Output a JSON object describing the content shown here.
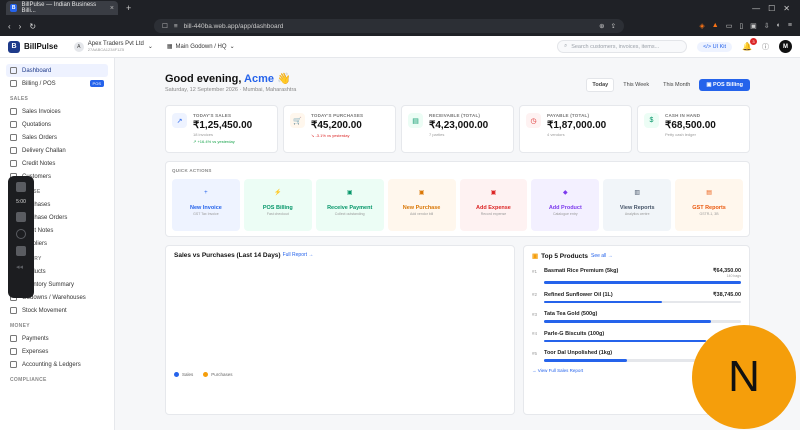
{
  "browser": {
    "tab_title": "BillPulse — Indian Business Billi...",
    "favicon_letter": "B",
    "url": "bill-440ba.web.app/app/dashboard"
  },
  "header": {
    "logo_text": "BillPulse",
    "logo_letter": "B",
    "company_initial": "A",
    "company_name": "Apex Traders Pvt Ltd",
    "company_sub": "27AABCA1234F1Z5",
    "godown": "Main Godown / HQ",
    "search_placeholder": "Search customers, invoices, items...",
    "uikit_label": "UI Kit",
    "notif_count": "3",
    "user_initial": "M"
  },
  "sidebar": {
    "top_items": [
      {
        "label": "Dashboard"
      },
      {
        "label": "Billing / POS",
        "badge": "POS"
      }
    ],
    "sections": [
      {
        "title": "SALES",
        "items": [
          "Sales Invoices",
          "Quotations",
          "Sales Orders",
          "Delivery Challan",
          "Credit Notes",
          "Customers"
        ]
      },
      {
        "title": "PURCHASE",
        "items": [
          "Purchases",
          "Purchase Orders",
          "Debit Notes",
          "Suppliers"
        ]
      },
      {
        "title": "INVENTORY",
        "items": [
          "Products",
          "Inventory Summary",
          "Godowns / Warehouses",
          "Stock Movement"
        ]
      },
      {
        "title": "MONEY",
        "items": [
          "Payments",
          "Expenses",
          "Accounting & Ledgers"
        ]
      },
      {
        "title": "COMPLIANCE",
        "items": []
      }
    ]
  },
  "recorder": {
    "time": "5:00"
  },
  "greeting": {
    "prefix": "Good evening, ",
    "name": "Acme",
    "emoji": "👋",
    "date": "Saturday, 12 September 2026 · Mumbai, Maharashtra"
  },
  "periods": [
    "Today",
    "This Week",
    "This Month"
  ],
  "pos_button": "POS Billing",
  "stats": [
    {
      "label": "TODAY'S SALES",
      "value": "₹1,25,450.00",
      "sub": "18 invoices",
      "trend": "↗ +16.4% vs yesterday",
      "color": "#2563eb",
      "bg": "#eef3ff",
      "icon": "↗"
    },
    {
      "label": "TODAY'S PURCHASES",
      "value": "₹45,200.00",
      "sub": "",
      "trend": "↘ -3.1% vs yesterday",
      "color": "#d97706",
      "bg": "#fff7ed",
      "icon": "🛒"
    },
    {
      "label": "RECEIVABLE (TOTAL)",
      "value": "₹4,23,000.00",
      "sub": "7 parties",
      "trend": "",
      "color": "#059669",
      "bg": "#ecfdf5",
      "icon": "▤"
    },
    {
      "label": "PAYABLE (TOTAL)",
      "value": "₹1,87,000.00",
      "sub": "4 vendors",
      "trend": "",
      "color": "#dc2626",
      "bg": "#fef2f2",
      "icon": "◷"
    },
    {
      "label": "CASH IN HAND",
      "value": "₹68,500.00",
      "sub": "Petty cash ledger",
      "trend": "",
      "color": "#059669",
      "bg": "#ecfdf5",
      "icon": "$"
    }
  ],
  "quick_actions": {
    "title": "QUICK ACTIONS",
    "items": [
      {
        "label": "New Invoice",
        "sub": "GST Tax Invoice",
        "color": "#2563eb",
        "bg": "#eef3ff",
        "icon": "+"
      },
      {
        "label": "POS Billing",
        "sub": "Fast checkout",
        "color": "#059669",
        "bg": "#ecfdf5",
        "icon": "⚡"
      },
      {
        "label": "Receive Payment",
        "sub": "Collect outstanding",
        "color": "#059669",
        "bg": "#ecfdf5",
        "icon": "▣"
      },
      {
        "label": "New Purchase",
        "sub": "Add vendor bill",
        "color": "#d97706",
        "bg": "#fff7ed",
        "icon": "▣"
      },
      {
        "label": "Add Expense",
        "sub": "Record expense",
        "color": "#dc2626",
        "bg": "#fef2f2",
        "icon": "▣"
      },
      {
        "label": "Add Product",
        "sub": "Catalogue entry",
        "color": "#7c3aed",
        "bg": "#f3f0ff",
        "icon": "◆"
      },
      {
        "label": "View Reports",
        "sub": "Analytics centre",
        "color": "#475569",
        "bg": "#f1f5f9",
        "icon": "▥"
      },
      {
        "label": "GST Reports",
        "sub": "GSTR-1, 3B",
        "color": "#ea580c",
        "bg": "#fff7ed",
        "icon": "▤"
      }
    ]
  },
  "sales_chart": {
    "title": "Sales vs Purchases (Last 14 Days)",
    "link": "Full Report →",
    "legend": [
      {
        "name": "Sales",
        "color": "#2563eb"
      },
      {
        "name": "Purchases",
        "color": "#f59e0b"
      }
    ]
  },
  "top_products": {
    "title": "Top 5 Products",
    "link": "See all →",
    "items": [
      {
        "rank": "#1",
        "name": "Basmati Rice Premium (5kg)",
        "amount": "₹64,350.00",
        "sub": "140 bags",
        "fill": 1.0
      },
      {
        "rank": "#2",
        "name": "Refined Sunflower Oil (1L)",
        "amount": "₹38,745.00",
        "sub": "",
        "fill": 0.6
      },
      {
        "rank": "#3",
        "name": "Tata Tea Gold (500g)",
        "amount": "",
        "sub": "",
        "fill": 0.85
      },
      {
        "rank": "#4",
        "name": "Parle-G Biscuits (100g)",
        "amount": "",
        "sub": "",
        "fill": 0.82
      },
      {
        "rank": "#5",
        "name": "Toor Dal Unpolished (1kg)",
        "amount": "",
        "sub": "",
        "fill": 0.42
      }
    ],
    "view_all": "→ View Full Sales Report"
  },
  "overlay_badge": "N"
}
